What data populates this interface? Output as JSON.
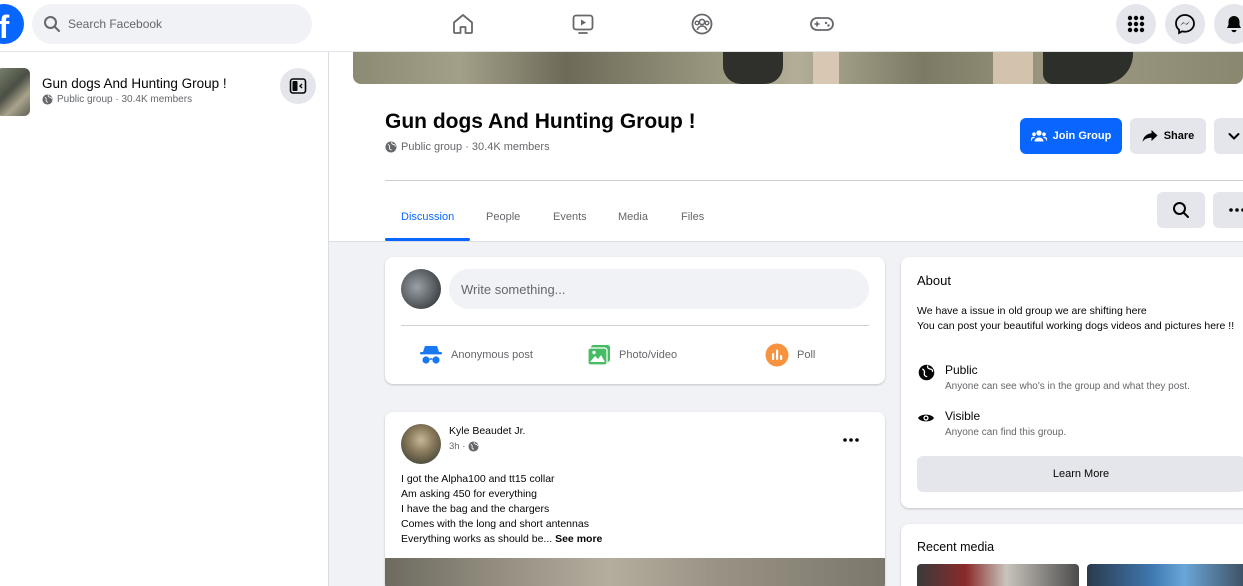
{
  "topbar": {
    "logo": "f",
    "search_placeholder": "Search Facebook"
  },
  "sidebar": {
    "group_name": "Gun dogs And Hunting Group !",
    "group_meta": "Public group · 30.4K members"
  },
  "group": {
    "title": "Gun dogs And Hunting Group !",
    "meta": "Public group · 30.4K members",
    "join_label": "Join Group",
    "share_label": "Share",
    "tabs": [
      {
        "label": "Discussion"
      },
      {
        "label": "People"
      },
      {
        "label": "Events"
      },
      {
        "label": "Media"
      },
      {
        "label": "Files"
      }
    ]
  },
  "composer": {
    "placeholder": "Write something...",
    "actions": [
      {
        "label": "Anonymous post"
      },
      {
        "label": "Photo/video"
      },
      {
        "label": "Poll"
      }
    ]
  },
  "post": {
    "author": "Kyle Beaudet Jr.",
    "time": "3h ·",
    "lines": [
      "I got the Alpha100 and tt15 collar",
      "Am asking 450 for everything",
      "I have the bag and the chargers",
      "Comes with the long and short antennas",
      "Everything works as should be..."
    ],
    "see_more": "See more"
  },
  "about": {
    "title": "About",
    "description_line1": "We have a issue in old group we are shifting here",
    "description_line2": "You can post your beautiful working dogs videos and pictures here !!",
    "public_title": "Public",
    "public_sub": "Anyone can see who's in the group and what they post.",
    "visible_title": "Visible",
    "visible_sub": "Anyone can find this group.",
    "learn_more": "Learn More"
  },
  "recent_media": {
    "title": "Recent media"
  },
  "colors": {
    "brand_blue": "#0866ff",
    "notification_red": "#e41e3f",
    "secondary_text": "#65676b"
  }
}
